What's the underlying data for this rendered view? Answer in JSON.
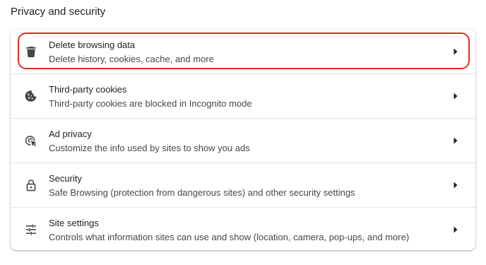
{
  "section": {
    "title": "Privacy and security"
  },
  "items": [
    {
      "title": "Delete browsing data",
      "subtitle": "Delete history, cookies, cache, and more",
      "icon": "trash-icon",
      "highlighted": true
    },
    {
      "title": "Third-party cookies",
      "subtitle": "Third-party cookies are blocked in Incognito mode",
      "icon": "cookie-icon",
      "highlighted": false
    },
    {
      "title": "Ad privacy",
      "subtitle": "Customize the info used by sites to show you ads",
      "icon": "ad-privacy-icon",
      "highlighted": false
    },
    {
      "title": "Security",
      "subtitle": "Safe Browsing (protection from dangerous sites) and other security settings",
      "icon": "lock-icon",
      "highlighted": false
    },
    {
      "title": "Site settings",
      "subtitle": "Controls what information sites can use and show (location, camera, pop-ups, and more)",
      "icon": "tune-icon",
      "highlighted": false
    }
  ],
  "colors": {
    "highlight_border": "#d93025",
    "icon": "#474747",
    "divider": "#e3e3e3"
  }
}
